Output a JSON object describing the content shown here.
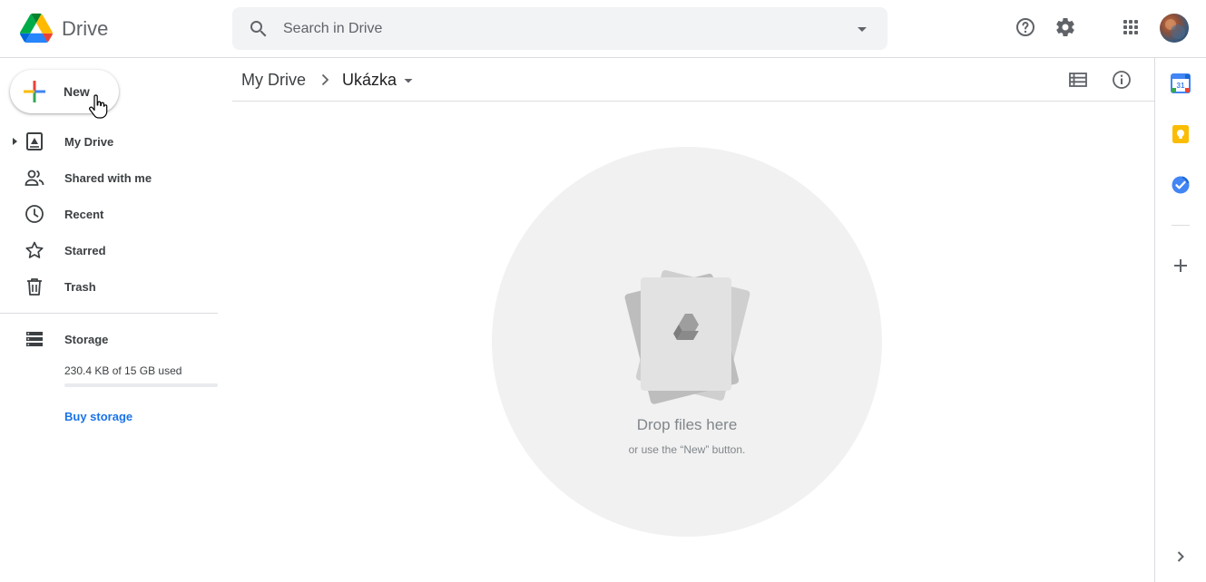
{
  "header": {
    "app_name": "Drive",
    "search_placeholder": "Search in Drive"
  },
  "sidebar": {
    "new_label": "New",
    "items": [
      {
        "label": "My Drive",
        "icon": "my-drive-icon"
      },
      {
        "label": "Shared with me",
        "icon": "shared-people-icon"
      },
      {
        "label": "Recent",
        "icon": "clock-icon"
      },
      {
        "label": "Starred",
        "icon": "star-icon"
      },
      {
        "label": "Trash",
        "icon": "trash-icon"
      }
    ],
    "storage": {
      "label": "Storage",
      "used_text": "230.4 KB of 15 GB used",
      "used_fraction": 1.5e-05,
      "buy_label": "Buy storage"
    }
  },
  "breadcrumb": {
    "root": "My Drive",
    "current": "Ukázka"
  },
  "empty_state": {
    "title": "Drop files here",
    "subtitle": "or use the “New” button."
  },
  "colors": {
    "accent": "#1a73e8",
    "drive_green": "#0f9d58",
    "drive_yellow": "#f4b400",
    "drive_blue": "#4285f4",
    "drive_red": "#db4437"
  }
}
